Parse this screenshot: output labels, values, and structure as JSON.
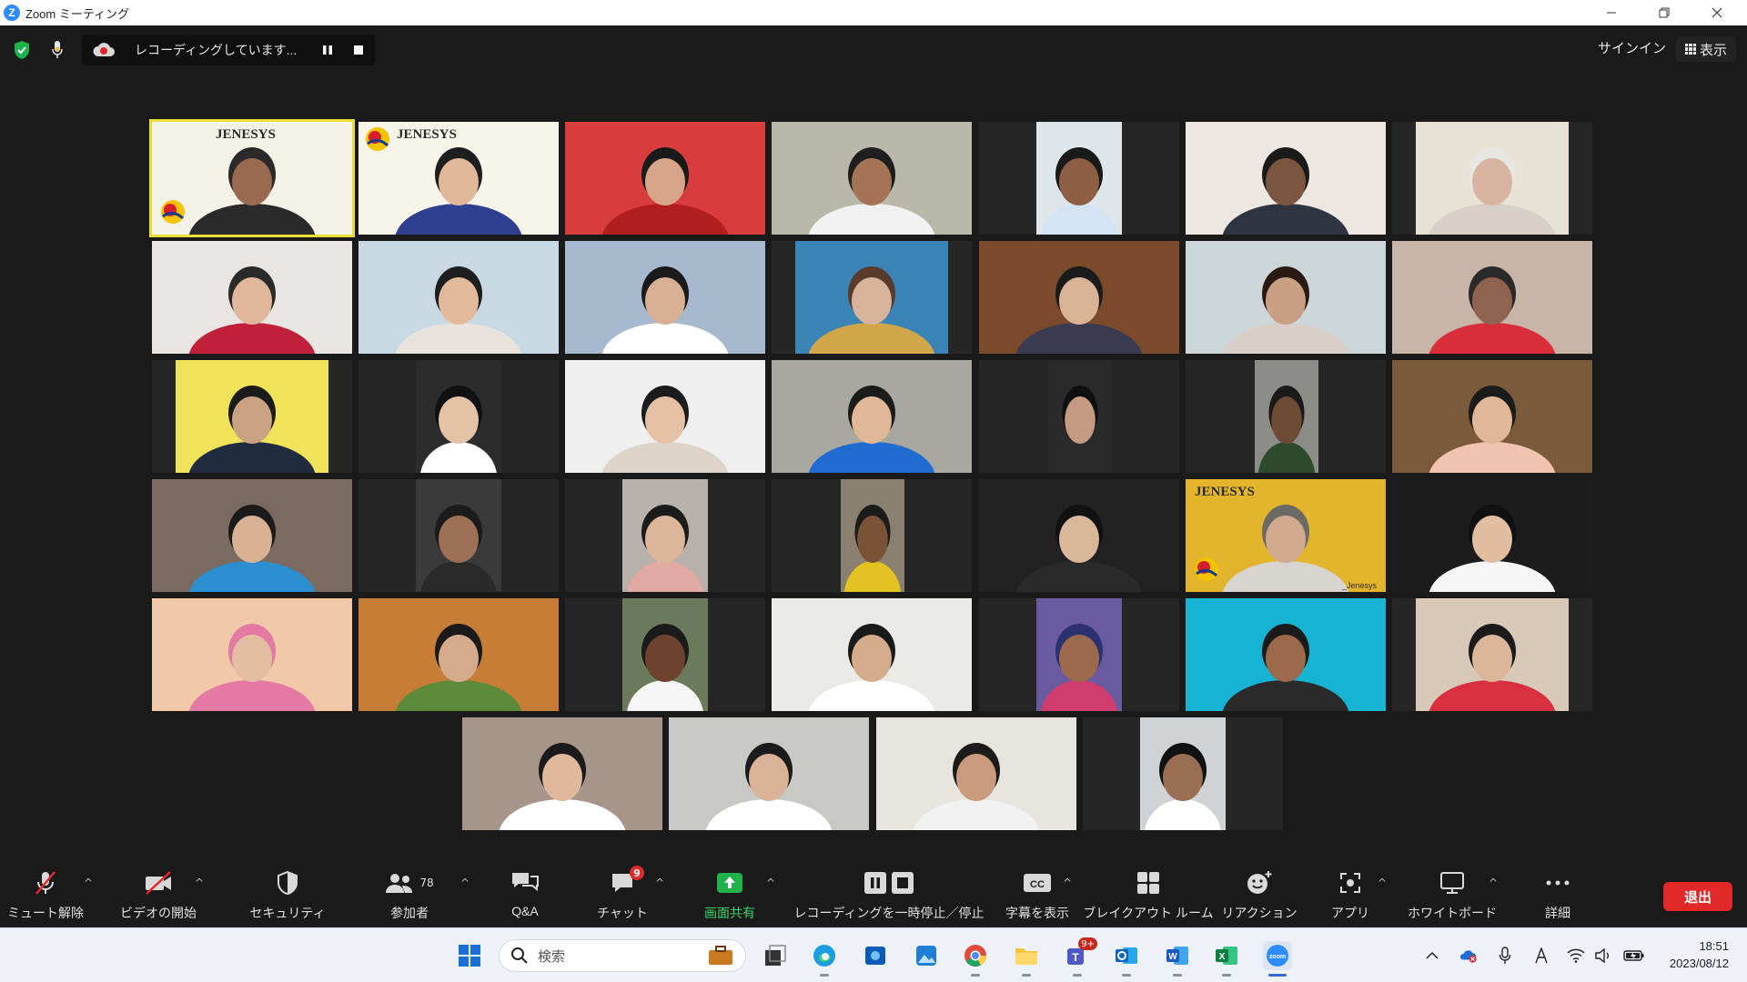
{
  "window": {
    "title": "Zoom ミーティング",
    "logo_letter": "Z",
    "controls": [
      "minimize-icon",
      "restore-icon",
      "close-icon"
    ]
  },
  "topbar": {
    "recording_text": "レコーディングしています...",
    "signin_label": "サインイン",
    "view_label": "表示"
  },
  "gallery": {
    "participant_count_visible": 39,
    "banner_text": "JENESYS",
    "banner_footer": "_Jenesys"
  },
  "toolbar": {
    "unmute_label": "ミュート解除",
    "start_video_label": "ビデオの開始",
    "security_label": "セキュリティ",
    "participants_label": "参加者",
    "participants_count": "78",
    "qa_label": "Q&A",
    "chat_label": "チャット",
    "chat_badge": "9",
    "share_label": "画面共有",
    "recording_label": "レコーディングを一時停止／停止",
    "captions_label": "字幕を表示",
    "captions_icon_text": "CC",
    "breakout_label": "ブレイクアウト ルーム",
    "reactions_label": "リアクション",
    "apps_label": "アプリ",
    "whiteboard_label": "ホワイトボード",
    "more_label": "詳細",
    "leave_label": "退出"
  },
  "taskbar": {
    "search_placeholder": "検索",
    "teams_badge": "9+",
    "zoom_label": "zoom",
    "time": "18:51",
    "date": "2023/08/12"
  },
  "colors": {
    "accent_green": "#3ad46b",
    "leave_red": "#e02828",
    "active_speaker": "#e8e036",
    "zoom_blue": "#2d8cff"
  }
}
